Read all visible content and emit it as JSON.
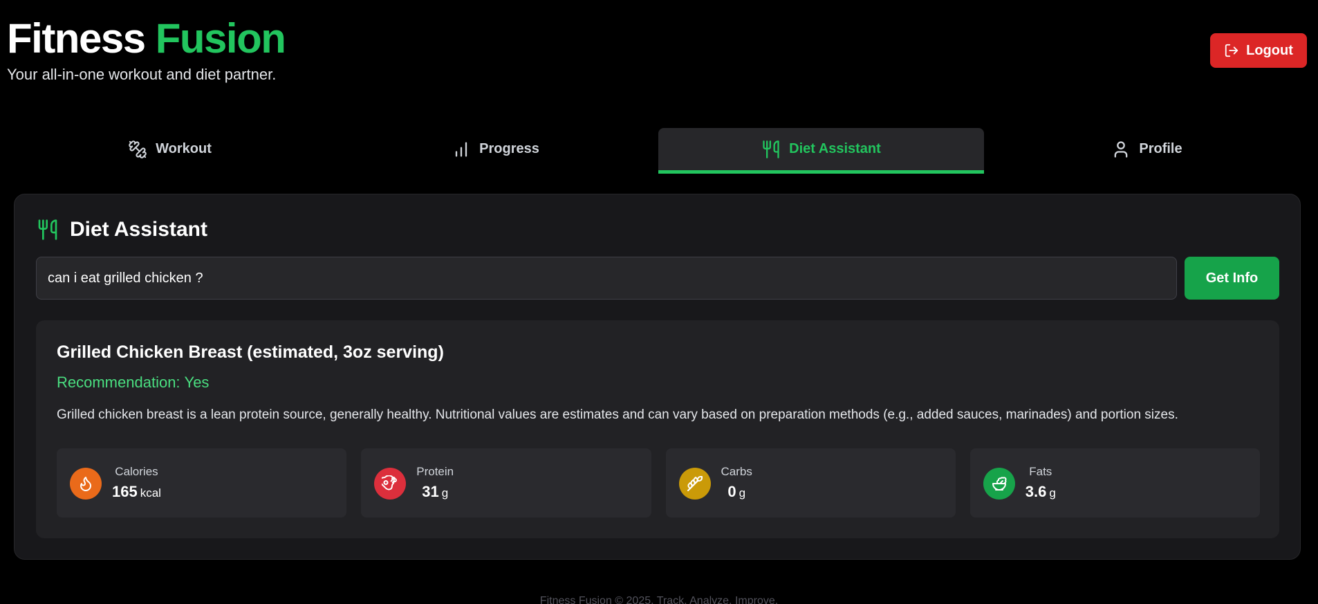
{
  "header": {
    "brand_part1": "Fitness",
    "brand_part2": "Fusion",
    "tagline": "Your all-in-one workout and diet partner.",
    "logout_label": "Logout",
    "logout_icon": "logout-icon"
  },
  "tabs": [
    {
      "label": "Workout",
      "icon": "dumbbell-icon",
      "active": false
    },
    {
      "label": "Progress",
      "icon": "bar-chart-icon",
      "active": false
    },
    {
      "label": "Diet Assistant",
      "icon": "utensils-icon",
      "active": true
    },
    {
      "label": "Profile",
      "icon": "user-icon",
      "active": false
    }
  ],
  "diet": {
    "title": "Diet Assistant",
    "query_value": "can i eat grilled chicken ?",
    "get_info_label": "Get Info",
    "result": {
      "food_title": "Grilled Chicken Breast (estimated, 3oz serving)",
      "recommendation_label": "Recommendation:",
      "recommendation_value": "Yes",
      "description": "Grilled chicken breast is a lean protein source, generally healthy. Nutritional values are estimates and can vary based on preparation methods (e.g., added sauces, marinades) and portion sizes.",
      "stats": [
        {
          "label": "Calories",
          "value": "165",
          "unit": "kcal",
          "icon": "flame-icon",
          "color": "#ea6a1a"
        },
        {
          "label": "Protein",
          "value": "31",
          "unit": "g",
          "icon": "meat-icon",
          "color": "#dc2f3c"
        },
        {
          "label": "Carbs",
          "value": "0",
          "unit": "g",
          "icon": "wheat-icon",
          "color": "#ca9a08"
        },
        {
          "label": "Fats",
          "value": "3.6",
          "unit": "g",
          "icon": "salad-icon",
          "color": "#17a34a"
        }
      ]
    }
  },
  "footer": {
    "text": "Fitness Fusion © 2025. Track. Analyze. Improve."
  },
  "colors": {
    "accent": "#22c55e",
    "danger": "#dc2626",
    "background": "#000000",
    "card": "#18181b"
  }
}
